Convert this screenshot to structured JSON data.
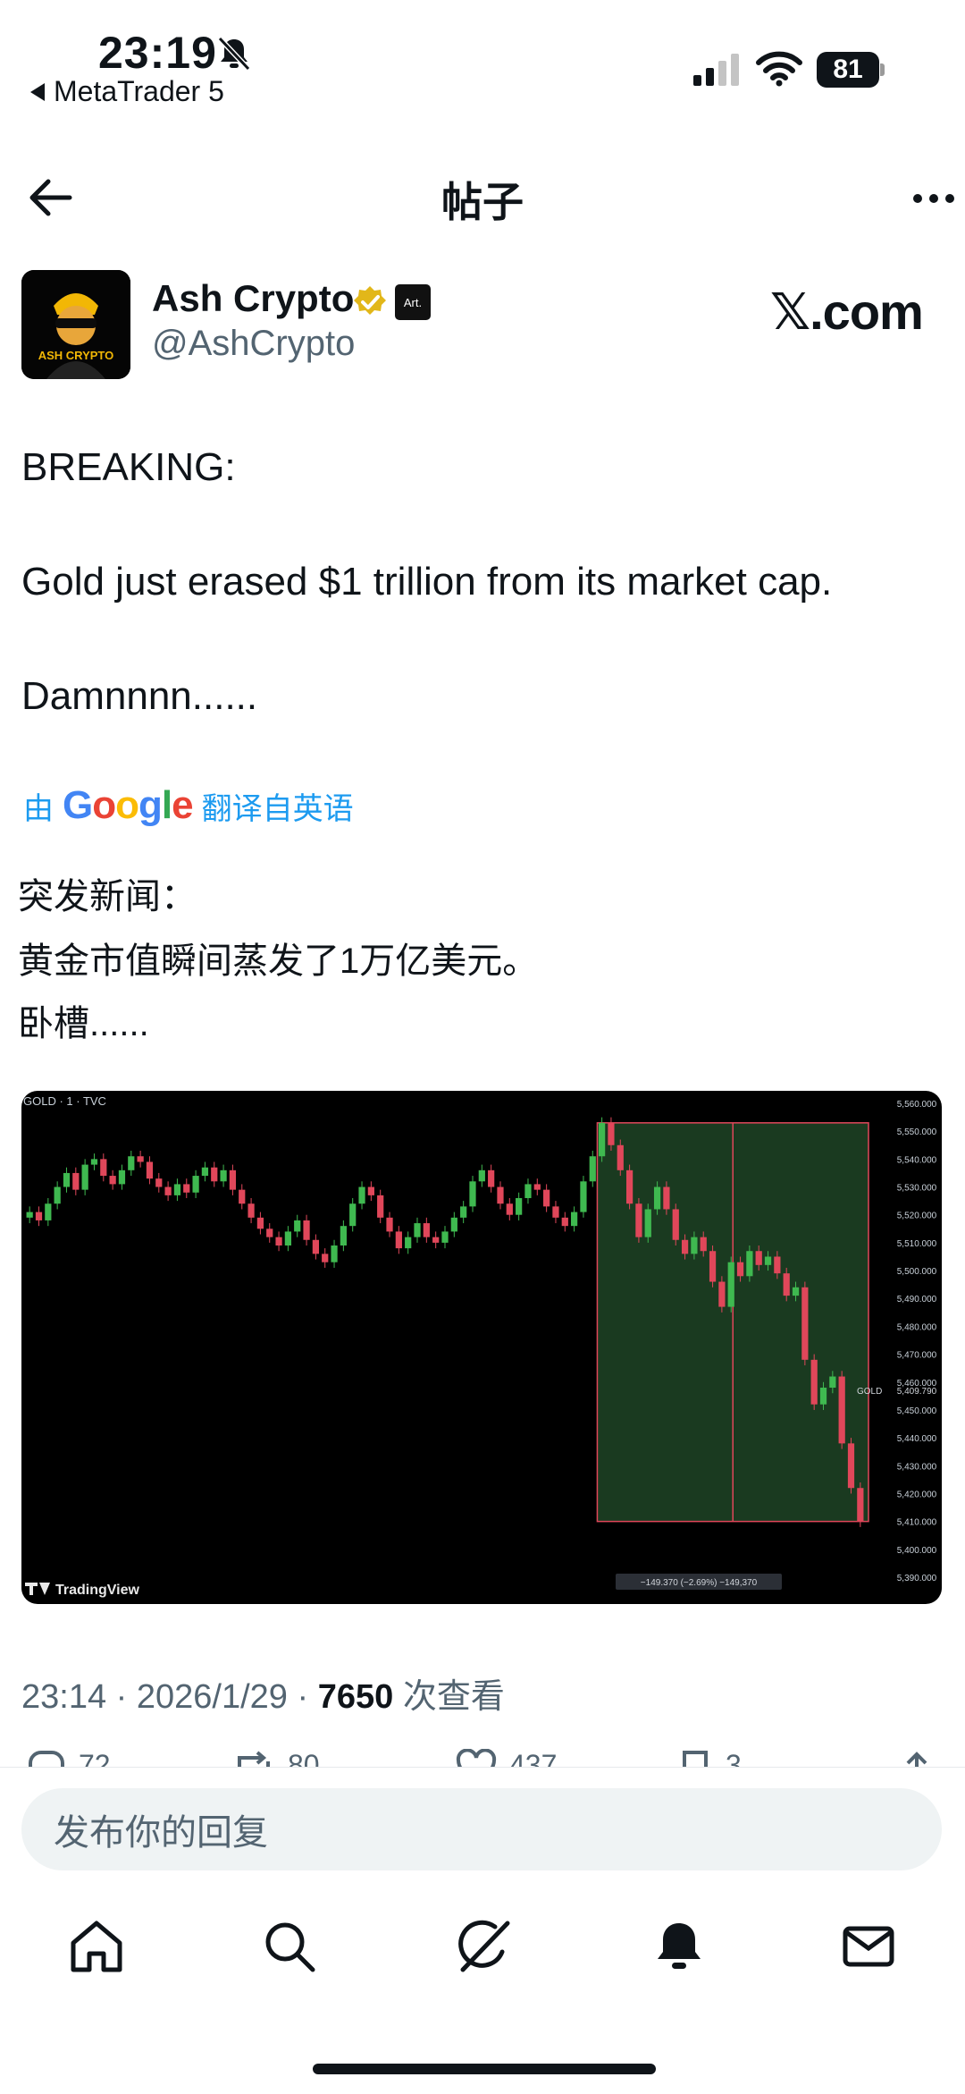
{
  "status_bar": {
    "time": "23:19",
    "back_app": "MetaTrader 5",
    "battery": "81"
  },
  "header": {
    "title": "帖子"
  },
  "author": {
    "name": "Ash Crypto",
    "handle": "@AshCrypto",
    "avatar_text": "ASH CRYPTO",
    "affiliate_badge": "Art.",
    "site_badge": "𝕏.com"
  },
  "tweet": {
    "lines": [
      "BREAKING:",
      "Gold just erased $1 trillion from its market cap.",
      "Damnnnn......"
    ],
    "translation_prefix": "由",
    "translation_brand": "Google",
    "translation_suffix": "翻译自英语",
    "translated_lines": [
      "突发新闻：",
      "黄金市值瞬间蒸发了1万亿美元。",
      "卧槽......"
    ]
  },
  "chart_data": {
    "type": "candlestick",
    "symbol_label": "GOLD · 1 · TVC",
    "price_labels": [
      "5,560.000",
      "5,550.000",
      "5,540.000",
      "5,530.000",
      "5,520.000",
      "5,510.000",
      "5,500.000",
      "5,490.000",
      "5,480.000",
      "5,470.000",
      "5,460.000",
      "5,450.000",
      "5,440.000",
      "5,430.000",
      "5,420.000",
      "5,410.000",
      "5,400.000",
      "5,390.000"
    ],
    "ylim": [
      5390,
      5560
    ],
    "close_series": [
      5521,
      5518,
      5524,
      5530,
      5535,
      5529,
      5538,
      5540,
      5534,
      5531,
      5536,
      5541,
      5539,
      5533,
      5530,
      5527,
      5531,
      5528,
      5534,
      5537,
      5532,
      5536,
      5529,
      5524,
      5519,
      5515,
      5512,
      5509,
      5514,
      5518,
      5511,
      5506,
      5503,
      5509,
      5516,
      5524,
      5530,
      5527,
      5519,
      5514,
      5508,
      5512,
      5517,
      5512,
      5510,
      5514,
      5519,
      5523,
      5532,
      5536,
      5530,
      5524,
      5520,
      5526,
      5531,
      5529,
      5523,
      5519,
      5516,
      5521,
      5532,
      5541,
      5553,
      5545,
      5536,
      5524,
      5512,
      5522,
      5530,
      5522,
      5511,
      5506,
      5512,
      5507,
      5496,
      5487,
      5503,
      5498,
      5507,
      5502,
      5505,
      5499,
      5491,
      5494,
      5468,
      5452,
      5458,
      5462,
      5438,
      5422,
      5410
    ],
    "measure_label": "−149.370 (−2.69%) −149,370",
    "last_price_label": "GOLD",
    "last_price": "5,409.790",
    "watermark": "TradingView"
  },
  "meta": {
    "time": "23:14",
    "date": "2026/1/29",
    "views": "7650",
    "views_label": "次查看"
  },
  "actions": {
    "replies": "72",
    "reposts": "80",
    "likes": "437",
    "bookmarks": "3"
  },
  "reply_placeholder": "发布你的回复",
  "colors": {
    "accent": "#1d9bf0",
    "up": "#3fb950",
    "down": "#e0475a",
    "measure_fill": "#1a3a20"
  }
}
